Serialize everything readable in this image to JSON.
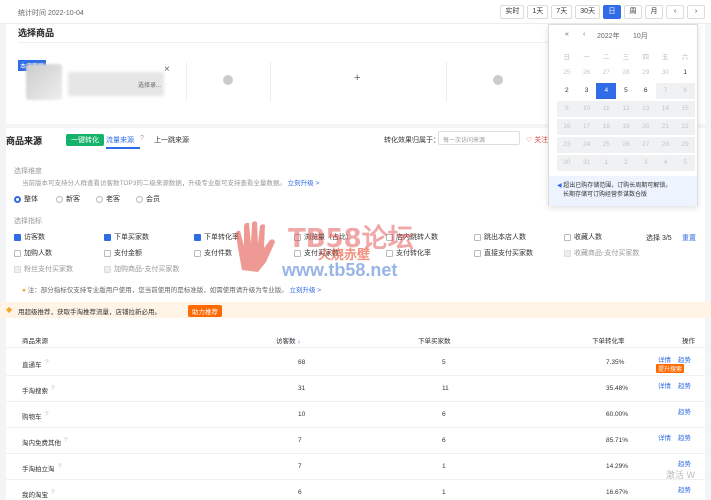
{
  "topbar": {
    "stat_time": "统计时间 2022-10-04",
    "ranges": [
      "实时",
      "1天",
      "7天",
      "30天",
      "日",
      "周",
      "月",
      "‹",
      "›"
    ],
    "active_range": "日"
  },
  "select_goods": {
    "title": "选择商品",
    "tag": "本店商品",
    "goods_sub": "选择录...",
    "plus": "+",
    "close": "×"
  },
  "source": {
    "title": "商品来源",
    "convert_button": "一键转化",
    "tabs": [
      "流量来源",
      "上一跳来源"
    ],
    "conv_label": "转化效果归属于：",
    "conv_placeholder": "每一次访问来源",
    "follow_label": "关注",
    "dim_label": "选择维度",
    "dim_note": "当前版本可支持分人群查看访客数TOP3的二级来源数据，升级专业版可支持查看全量数据。",
    "upgrade_link": "立刻升级 >",
    "dimensions": [
      "整体",
      "新客",
      "老客",
      "会员"
    ],
    "metric_label": "选择指标",
    "pick_count": "选择 3/5",
    "reset": "重置",
    "metrics": [
      {
        "label": "访客数",
        "checked": true,
        "disabled": false
      },
      {
        "label": "下单买家数",
        "checked": true,
        "disabled": false
      },
      {
        "label": "下单转化率",
        "checked": true,
        "disabled": false
      },
      {
        "label": "浏览量（占比）",
        "checked": false,
        "disabled": false
      },
      {
        "label": "店内跳转人数",
        "checked": false,
        "disabled": false
      },
      {
        "label": "跳出本店人数",
        "checked": false,
        "disabled": false
      },
      {
        "label": "收藏人数",
        "checked": false,
        "disabled": false
      },
      {
        "label": "加购人数",
        "checked": false,
        "disabled": false
      },
      {
        "label": "支付金额",
        "checked": false,
        "disabled": false
      },
      {
        "label": "支付件数",
        "checked": false,
        "disabled": false
      },
      {
        "label": "支付买家数",
        "checked": false,
        "disabled": false
      },
      {
        "label": "支付转化率",
        "checked": false,
        "disabled": false
      },
      {
        "label": "直接支付买家数",
        "checked": false,
        "disabled": false
      },
      {
        "label": "收藏商品-支付买家数",
        "checked": false,
        "disabled": true
      },
      {
        "label": "粉丝支付买家数",
        "checked": false,
        "disabled": true
      },
      {
        "label": "加购商品-支付买家数",
        "checked": false,
        "disabled": true
      }
    ],
    "metric_note": "注：部分指标仅支持专业版用户使用，您当前使用的是标准版，如需使用请升级为专业版。",
    "metric_upgrade": "立刻升级 >"
  },
  "info_bar": {
    "text": "用超级推荐，获取手淘推荐流量，店铺拉新必用。",
    "button": "助力推荐"
  },
  "table": {
    "headers": [
      "商品来源",
      "访客数",
      "下单买家数",
      "下单转化率",
      "操作"
    ],
    "rows": [
      {
        "source": "直通车",
        "visitors": "68",
        "buyers": "5",
        "rate": "7.35%",
        "ops": [
          "详情",
          "趋势"
        ],
        "tag": "提升搜索"
      },
      {
        "source": "手淘搜索",
        "visitors": "31",
        "buyers": "11",
        "rate": "35.48%",
        "ops": [
          "详情",
          "趋势"
        ],
        "tag": ""
      },
      {
        "source": "购物车",
        "visitors": "10",
        "buyers": "6",
        "rate": "60.00%",
        "ops": [
          "",
          "趋势"
        ],
        "tag": ""
      },
      {
        "source": "淘内免费其他",
        "visitors": "7",
        "buyers": "6",
        "rate": "85.71%",
        "ops": [
          "详情",
          "趋势"
        ],
        "tag": ""
      },
      {
        "source": "手淘拍立淘",
        "visitors": "7",
        "buyers": "1",
        "rate": "14.29%",
        "ops": [
          "",
          "趋势"
        ],
        "tag": ""
      },
      {
        "source": "我的淘宝",
        "visitors": "6",
        "buyers": "1",
        "rate": "16.67%",
        "ops": [
          "",
          "趋势"
        ],
        "tag": ""
      }
    ]
  },
  "calendar": {
    "nav_prev_year": "«",
    "nav_prev_month": "‹",
    "year": "2022年",
    "month": "10月",
    "weekdays": [
      "日",
      "一",
      "二",
      "三",
      "四",
      "五",
      "六"
    ],
    "days": [
      {
        "d": "25",
        "s": "muted"
      },
      {
        "d": "26",
        "s": "muted"
      },
      {
        "d": "27",
        "s": "muted"
      },
      {
        "d": "28",
        "s": "muted"
      },
      {
        "d": "29",
        "s": "muted"
      },
      {
        "d": "30",
        "s": "muted"
      },
      {
        "d": "1",
        "s": ""
      },
      {
        "d": "2",
        "s": ""
      },
      {
        "d": "3",
        "s": ""
      },
      {
        "d": "4",
        "s": "sel"
      },
      {
        "d": "5",
        "s": ""
      },
      {
        "d": "6",
        "s": ""
      },
      {
        "d": "7",
        "s": "dis"
      },
      {
        "d": "8",
        "s": "dis"
      },
      {
        "d": "9",
        "s": "dis"
      },
      {
        "d": "10",
        "s": "dis"
      },
      {
        "d": "11",
        "s": "dis"
      },
      {
        "d": "12",
        "s": "dis"
      },
      {
        "d": "13",
        "s": "dis"
      },
      {
        "d": "14",
        "s": "dis"
      },
      {
        "d": "15",
        "s": "dis"
      },
      {
        "d": "16",
        "s": "dis"
      },
      {
        "d": "17",
        "s": "dis"
      },
      {
        "d": "18",
        "s": "dis"
      },
      {
        "d": "19",
        "s": "dis"
      },
      {
        "d": "20",
        "s": "dis"
      },
      {
        "d": "21",
        "s": "dis"
      },
      {
        "d": "22",
        "s": "dis"
      },
      {
        "d": "23",
        "s": "dis"
      },
      {
        "d": "24",
        "s": "dis"
      },
      {
        "d": "25",
        "s": "dis"
      },
      {
        "d": "26",
        "s": "dis"
      },
      {
        "d": "27",
        "s": "dis"
      },
      {
        "d": "28",
        "s": "dis"
      },
      {
        "d": "29",
        "s": "dis"
      },
      {
        "d": "30",
        "s": "dis"
      },
      {
        "d": "31",
        "s": "dis"
      },
      {
        "d": "1",
        "s": "dis"
      },
      {
        "d": "2",
        "s": "dis"
      },
      {
        "d": "3",
        "s": "dis"
      },
      {
        "d": "4",
        "s": "dis"
      },
      {
        "d": "5",
        "s": "dis"
      }
    ],
    "tip_line1": "超出已购存储范围，订购长周期可解锁。",
    "tip_line2": "长期存储可订购经营参谋数仓版"
  },
  "watermark": {
    "line1": "TB58论坛",
    "line2": "火烧赤壁",
    "line3": "www.tb58.net"
  },
  "corner_text": "激活 W"
}
